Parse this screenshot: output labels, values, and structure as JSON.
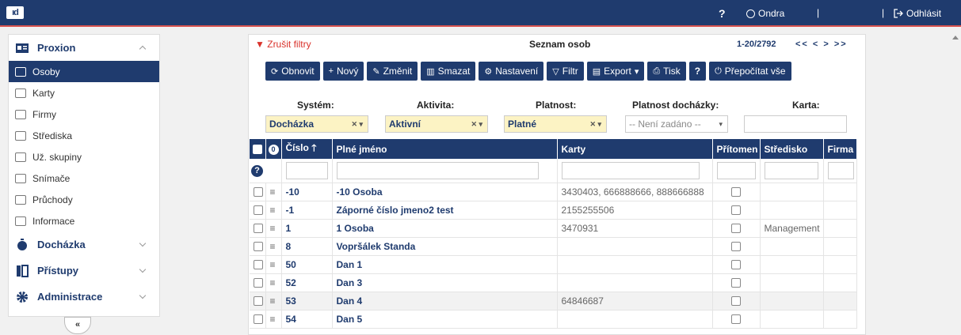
{
  "topbar": {
    "logo": "ıd",
    "help": "?",
    "user": "Ondra",
    "sep": "|",
    "logout": "Odhlásit"
  },
  "sidebar": {
    "section_proxion": "Proxion",
    "items": [
      {
        "label": "Osoby",
        "icon": "people-icon"
      },
      {
        "label": "Karty",
        "icon": "card-icon"
      },
      {
        "label": "Firmy",
        "icon": "company-icon"
      },
      {
        "label": "Střediska",
        "icon": "center-icon"
      },
      {
        "label": "Už. skupiny",
        "icon": "user-groups-icon"
      },
      {
        "label": "Snímače",
        "icon": "reader-icon"
      },
      {
        "label": "Průchody",
        "icon": "passage-icon"
      },
      {
        "label": "Informace",
        "icon": "info-icon"
      }
    ],
    "section_dochazka": "Docházka",
    "section_pristupy": "Přístupy",
    "section_administrace": "Administrace",
    "collapse": "«"
  },
  "main": {
    "clear_filters": "Zrušit filtry",
    "title": "Seznam osob",
    "pager": "1-20/2792",
    "pager_nav": "<< < > >>",
    "toolbar": {
      "refresh": "Obnovit",
      "new": "Nový",
      "edit": "Změnit",
      "delete": "Smazat",
      "settings": "Nastavení",
      "filter": "Filtr",
      "export": "Export",
      "print": "Tisk",
      "help": "?",
      "recalc": "Přepočítat vše"
    },
    "filters": {
      "system_label": "Systém:",
      "system_value": "Docházka",
      "activity_label": "Aktivita:",
      "activity_value": "Aktivní",
      "validity_label": "Platnost:",
      "validity_value": "Platné",
      "att_validity_label": "Platnost docházky:",
      "att_validity_value": "-- Není zadáno --",
      "card_label": "Karta:"
    },
    "table": {
      "headers": {
        "zero": "0",
        "number": "Číslo",
        "full_name": "Plné jméno",
        "cards": "Karty",
        "present": "Přítomen",
        "center": "Středisko",
        "company": "Firma"
      },
      "rows": [
        {
          "number": "-10",
          "name": "-10 Osoba",
          "cards": "3430403, 666888666, 888666888",
          "center": ""
        },
        {
          "number": "-1",
          "name": "Záporné číslo jmeno2 test",
          "cards": "2155255506",
          "center": ""
        },
        {
          "number": "1",
          "name": "1 Osoba",
          "cards": "3470931",
          "center": "Management"
        },
        {
          "number": "8",
          "name": "Vopršálek Standa",
          "cards": "",
          "center": ""
        },
        {
          "number": "50",
          "name": "Dan 1",
          "cards": "",
          "center": ""
        },
        {
          "number": "52",
          "name": "Dan 3",
          "cards": "",
          "center": ""
        },
        {
          "number": "53",
          "name": "Dan 4",
          "cards": "64846687",
          "center": ""
        },
        {
          "number": "54",
          "name": "Dan 5",
          "cards": "",
          "center": ""
        }
      ]
    }
  },
  "colors": {
    "primary": "#1f3b6e",
    "accent_red": "#d9322b",
    "filter_yellow": "#fcf3c4"
  }
}
